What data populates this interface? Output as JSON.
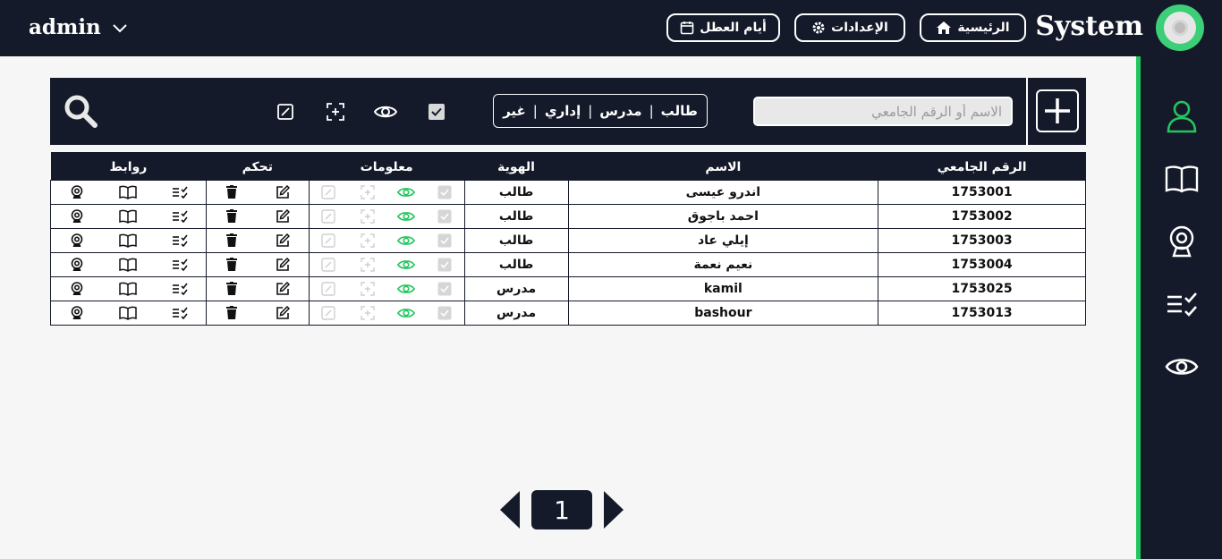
{
  "header": {
    "user": "admin",
    "brand": "System",
    "nav": {
      "home": "الرئيسية",
      "settings": "الإعدادات",
      "holidays": "أيام العطل"
    }
  },
  "toolbar": {
    "search_placeholder": "الاسم أو الرقم الجامعي",
    "filters": [
      "طالب",
      "مدرس",
      "إداري",
      "غير"
    ]
  },
  "table": {
    "headers": {
      "id": "الرقم الجامعي",
      "name": "الاسم",
      "role": "الهوية",
      "info": "معلومات",
      "control": "تحكم",
      "links": "روابط"
    },
    "rows": [
      {
        "id": "1753001",
        "name": "اندرو عيسى",
        "role": "طالب"
      },
      {
        "id": "1753002",
        "name": "احمد باجوق",
        "role": "طالب"
      },
      {
        "id": "1753003",
        "name": "إيلي عاد",
        "role": "طالب"
      },
      {
        "id": "1753004",
        "name": "نعيم نعمة",
        "role": "طالب"
      },
      {
        "id": "1753025",
        "name": "kamil",
        "role": "مدرس"
      },
      {
        "id": "1753013",
        "name": "bashour",
        "role": "مدرس"
      }
    ]
  },
  "pagination": {
    "current": "1"
  },
  "colors": {
    "dark": "#141a29",
    "accent": "#22c55e"
  },
  "icons": {
    "sidebar": [
      "user-icon",
      "book-icon",
      "webcam-icon",
      "checklist-icon",
      "eye-icon"
    ],
    "toolbar": [
      "checkbox-icon",
      "eye-icon",
      "focus-add-icon",
      "edit-square-icon",
      "search-icon"
    ]
  }
}
